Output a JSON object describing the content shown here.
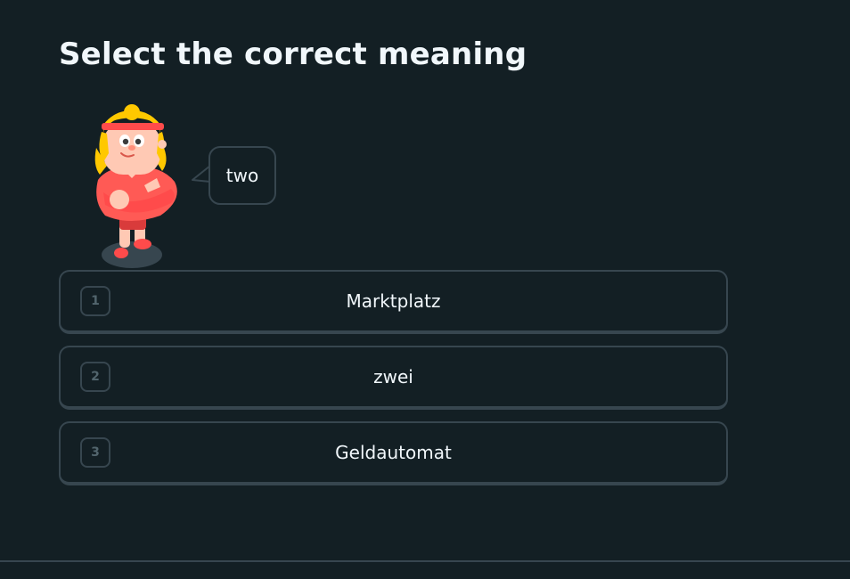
{
  "header": {
    "title": "Select the correct meaning"
  },
  "prompt": {
    "word": "two"
  },
  "choices": [
    {
      "number": "1",
      "label": "Marktplatz"
    },
    {
      "number": "2",
      "label": "zwei"
    },
    {
      "number": "3",
      "label": "Geldautomat"
    }
  ],
  "colors": {
    "background": "#131f24",
    "border": "#37464f",
    "text": "#f1f7fb",
    "muted": "#52656d",
    "character_shirt": "#ff5a55",
    "character_hair": "#ffc800"
  },
  "icons": {
    "character": "lily-character-icon",
    "speech_bubble": "speech-bubble-icon"
  }
}
